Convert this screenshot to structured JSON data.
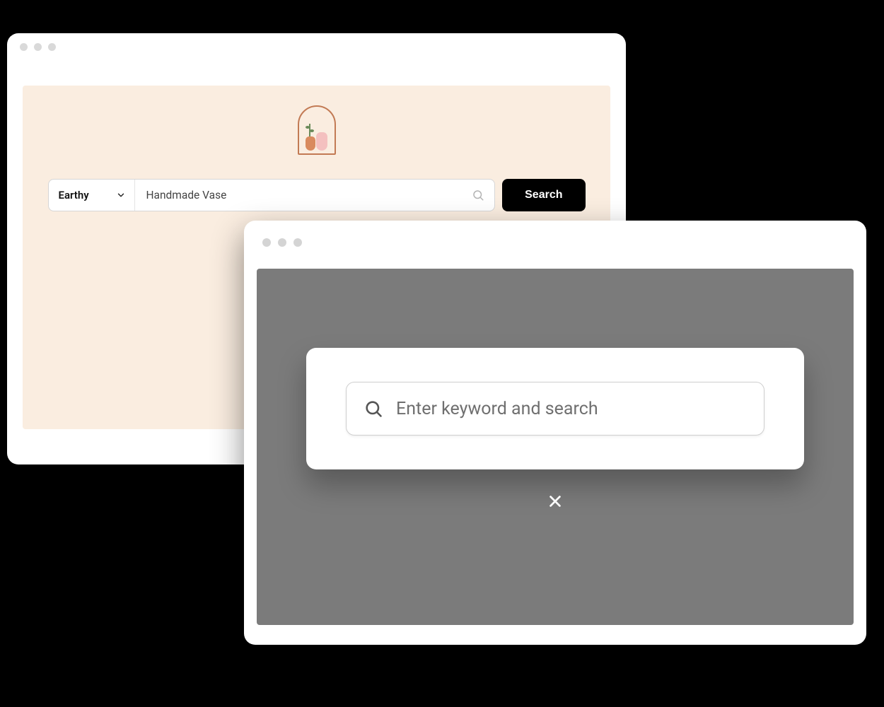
{
  "back": {
    "category_selected": "Earthy",
    "search_value": "Handmade Vase",
    "search_button_label": "Search",
    "icons": {
      "chevron": "chevron-down-icon",
      "magnifier": "search-icon"
    }
  },
  "front": {
    "modal_placeholder": "Enter keyword and search",
    "icons": {
      "magnifier": "search-icon",
      "close": "close-icon"
    }
  }
}
